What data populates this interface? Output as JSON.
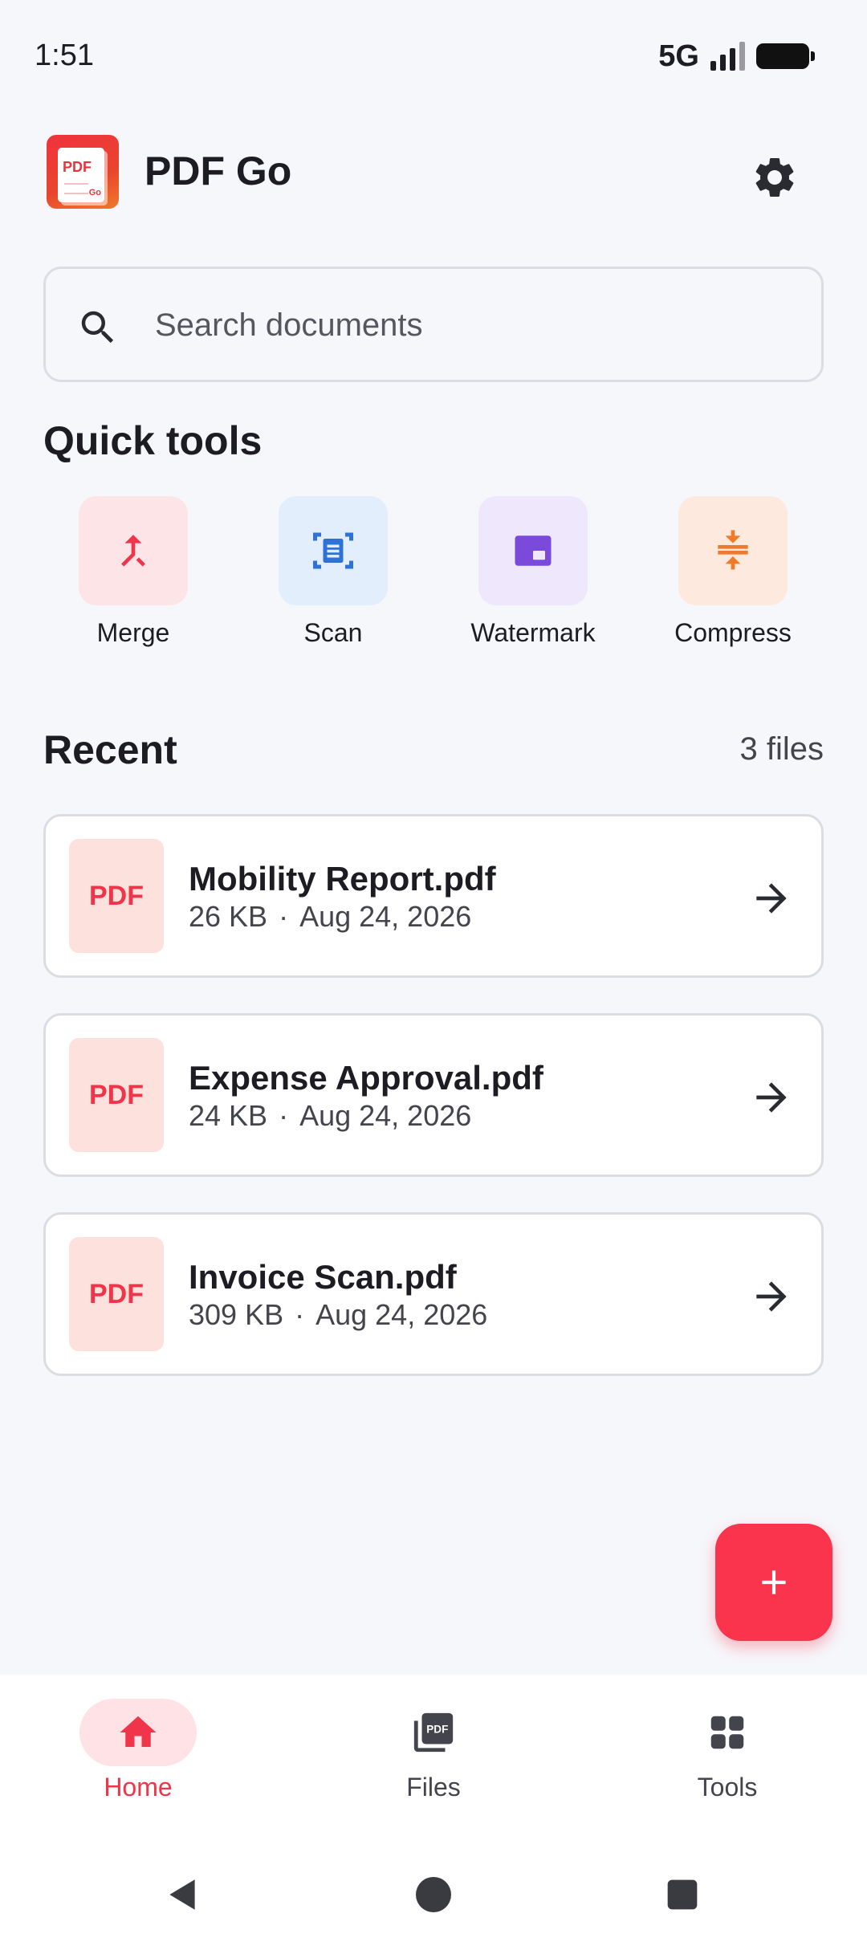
{
  "status_bar": {
    "time": "1:51",
    "network": "5G"
  },
  "header": {
    "app_name": "PDF Go",
    "logo_text": "PDF",
    "logo_badge": "Go"
  },
  "search": {
    "placeholder": "Search documents",
    "value": ""
  },
  "quick_tools": {
    "title": "Quick tools",
    "items": [
      {
        "label": "Merge",
        "icon": "merge-icon",
        "bg": "#fde4e7",
        "color": "#f0354a"
      },
      {
        "label": "Scan",
        "icon": "scan-icon",
        "bg": "#e3eefd",
        "color": "#2f72d6"
      },
      {
        "label": "Watermark",
        "icon": "watermark-icon",
        "bg": "#efe8fd",
        "color": "#7a4bdb"
      },
      {
        "label": "Compress",
        "icon": "compress-icon",
        "bg": "#fde9dd",
        "color": "#f07a2a"
      }
    ]
  },
  "recent": {
    "title": "Recent",
    "count_label": "3 files",
    "files": [
      {
        "thumb": "PDF",
        "name": "Mobility Report.pdf",
        "size": "26 KB",
        "separator": "·",
        "date": "Aug 24, 2026"
      },
      {
        "thumb": "PDF",
        "name": "Expense Approval.pdf",
        "size": "24 KB",
        "separator": "·",
        "date": "Aug 24, 2026"
      },
      {
        "thumb": "PDF",
        "name": "Invoice Scan.pdf",
        "size": "309 KB",
        "separator": "·",
        "date": "Aug 24, 2026"
      }
    ]
  },
  "fab": {
    "icon": "plus-icon"
  },
  "bottom_nav": {
    "items": [
      {
        "label": "Home",
        "icon": "home-icon",
        "active": true
      },
      {
        "label": "Files",
        "icon": "pdf-files-icon",
        "active": false
      },
      {
        "label": "Tools",
        "icon": "grid-icon",
        "active": false
      }
    ],
    "files_icon_text": "PDF"
  },
  "colors": {
    "accent": "#fa344c",
    "background": "#f6f7fb",
    "card_border": "#dcdde3",
    "text_primary": "#1c1c22",
    "text_secondary": "#44454c"
  }
}
